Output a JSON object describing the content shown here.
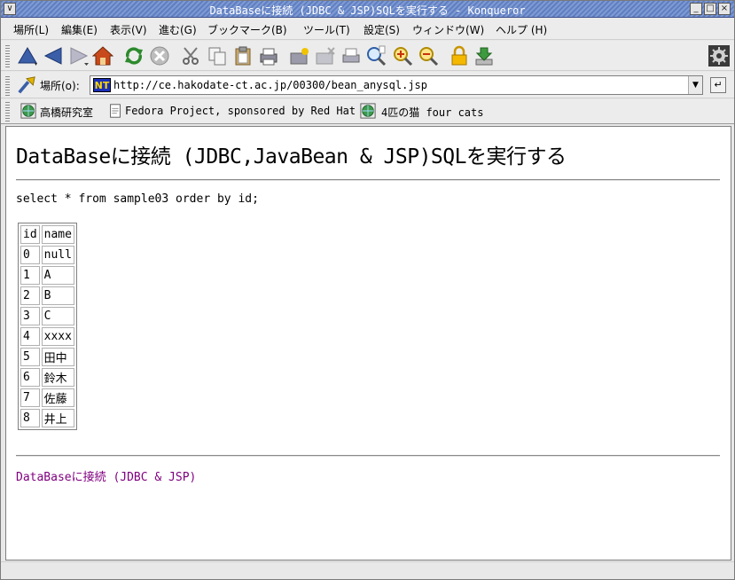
{
  "window": {
    "title": "DataBaseに接続 (JDBC & JSP)SQLを実行する - Konqueror"
  },
  "menu": [
    "場所(L)",
    "編集(E)",
    "表示(V)",
    "進む(G)",
    "ブックマーク(B)",
    "ツール(T)",
    "設定(S)",
    "ウィンドウ(W)",
    "ヘルプ (H)"
  ],
  "toolbar": {
    "icons": [
      "up-icon",
      "back-icon",
      "forward-icon",
      "home-icon",
      "reload-icon",
      "stop-icon",
      "cut-icon",
      "copy-icon",
      "paste-icon",
      "print-icon",
      "find-icon",
      "zoom-in-icon",
      "zoom-out-icon",
      "security-lock-icon",
      "download-icon",
      "konqueror-gear-icon"
    ]
  },
  "location": {
    "label": "場所(o):",
    "url": "http://ce.hakodate-ct.ac.jp/00300/bean_anysql.jsp",
    "site_icon_text": "NT"
  },
  "bookmarks": [
    {
      "label": "高橋研究室",
      "icon": "globe-icon"
    },
    {
      "label": "Fedora Project, sponsored by Red Hat",
      "icon": "page-icon"
    },
    {
      "label": "4匹の猫 four cats",
      "icon": "globe-icon"
    }
  ],
  "page": {
    "heading": "DataBaseに接続 (JDBC,JavaBean & JSP)SQLを実行する",
    "query": "select * from sample03 order by id;",
    "table": {
      "headers": [
        "id",
        "name"
      ],
      "rows": [
        [
          "0",
          "null"
        ],
        [
          "1",
          "A"
        ],
        [
          "2",
          "B"
        ],
        [
          "3",
          "C"
        ],
        [
          "4",
          "xxxx"
        ],
        [
          "5",
          "田中"
        ],
        [
          "6",
          "鈴木"
        ],
        [
          "7",
          "佐藤"
        ],
        [
          "8",
          "井上"
        ]
      ]
    },
    "footer_link": "DataBaseに接続 (JDBC & JSP)"
  }
}
